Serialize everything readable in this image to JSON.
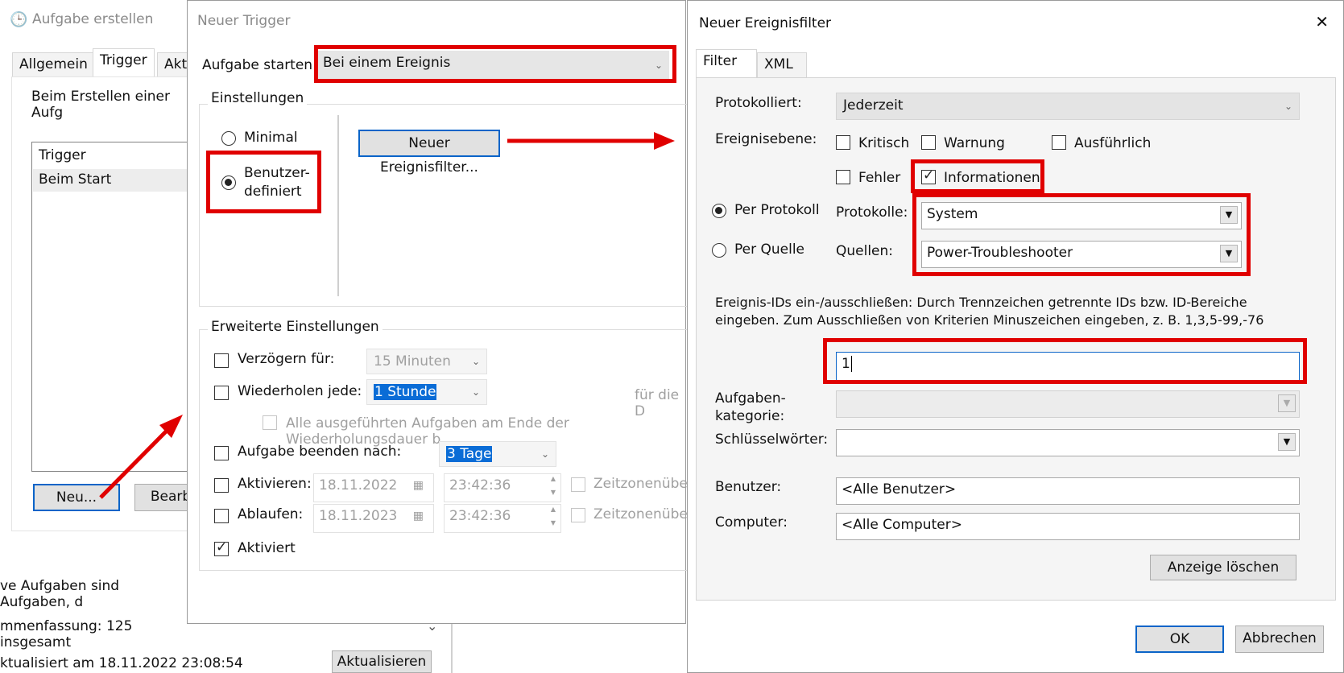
{
  "back_window": {
    "title": "Aufgabe erstellen",
    "tabs": [
      "Allgemein",
      "Trigger",
      "Akti"
    ],
    "description": "Beim Erstellen einer Aufg",
    "table_header": "Trigger",
    "table_row": "Beim Start",
    "new_button": "Neu...",
    "edit_button": "Bearb"
  },
  "bg_panel": {
    "line1": "ve Aufgaben sind Aufgaben, d",
    "line2": "mmenfassung: 125 insgesamt",
    "line3": "ktualisiert am 18.11.2022 23:08:54",
    "refresh_button": "Aktualisieren"
  },
  "trigger_dialog": {
    "title": "Neuer Trigger",
    "start_label": "Aufgabe starten:",
    "start_value": "Bei einem Ereignis",
    "settings_group": "Einstellungen",
    "radio_minimal": "Minimal",
    "radio_custom_line1": "Benutzer-",
    "radio_custom_line2": "definiert",
    "filter_button": "Neuer Ereignisfilter...",
    "advanced_group": "Erweiterte Einstellungen",
    "delay_label": "Verzögern für:",
    "delay_value": "15 Minuten",
    "repeat_label": "Wiederholen jede:",
    "repeat_value": "1 Stunde",
    "for_duration": "für die D",
    "stop_all_label": "Alle ausgeführten Aufgaben am Ende der Wiederholungsdauer b",
    "stop_after_label": "Aufgabe beenden nach:",
    "stop_after_value": "3 Tage",
    "activate_label": "Aktivieren:",
    "activate_date": "18.11.2022",
    "activate_time": "23:42:36",
    "expire_label": "Ablaufen:",
    "expire_date": "18.11.2023",
    "expire_time": "23:42:36",
    "timezone_label": "Zeitzonenüberg",
    "enabled_label": "Aktiviert"
  },
  "filter_dialog": {
    "title": "Neuer Ereignisfilter",
    "close_glyph": "✕",
    "tab_filter": "Filter",
    "tab_xml": "XML",
    "logged_label": "Protokolliert:",
    "logged_value": "Jederzeit",
    "level_label": "Ereignisebene:",
    "level_critical": "Kritisch",
    "level_warning": "Warnung",
    "level_verbose": "Ausführlich",
    "level_error": "Fehler",
    "level_info": "Informationen",
    "by_log": "Per Protokoll",
    "by_source": "Per Quelle",
    "logs_label": "Protokolle:",
    "logs_value": "System",
    "sources_label": "Quellen:",
    "sources_value": "Power-Troubleshooter",
    "ids_help_line1": "Ereignis-IDs ein-/ausschließen: Durch Trennzeichen getrennte IDs bzw. ID-Bereiche",
    "ids_help_line2": "eingeben. Zum Ausschließen von Kriterien Minuszeichen eingeben, z. B. 1,3,5-99,-76",
    "ids_value": "1",
    "task_cat_line1": "Aufgaben-",
    "task_cat_line2": "kategorie:",
    "keywords_label": "Schlüsselwörter:",
    "user_label": "Benutzer:",
    "user_value": "<Alle Benutzer>",
    "computer_label": "Computer:",
    "computer_value": "<Alle Computer>",
    "clear_button": "Anzeige löschen",
    "ok_button": "OK",
    "cancel_button": "Abbrechen"
  },
  "icons": {
    "clock": "🕒",
    "dropdown": "▼",
    "chevron": "⌄",
    "calendar": "▦",
    "spin_up": "▲",
    "spin_down": "▼"
  },
  "colors": {
    "highlight": "#e00000",
    "arrow": "#e00000",
    "focus": "#0a64c8",
    "selection": "#0a6cd6"
  }
}
